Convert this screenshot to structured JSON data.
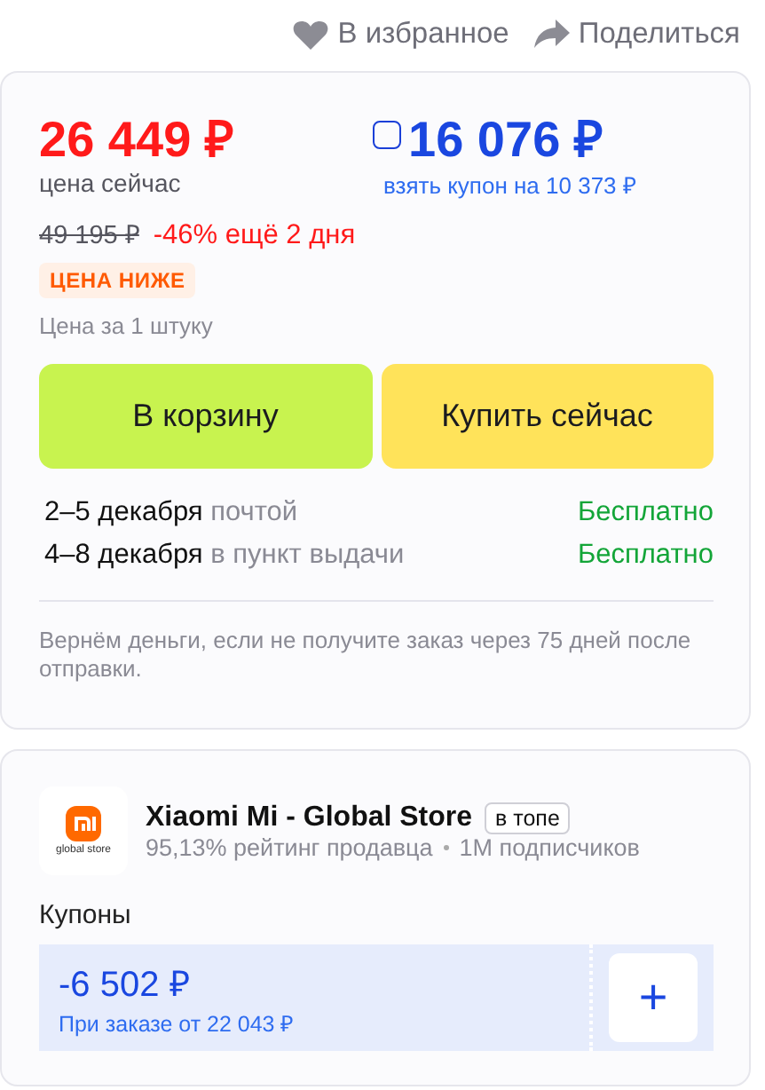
{
  "actions": [
    {
      "kind": "favorite",
      "label": "В избранное"
    },
    {
      "kind": "share",
      "label": "Поделиться"
    }
  ],
  "price": {
    "current": "26 449 ₽",
    "current_caption": "цена сейчас",
    "coupon_checked": false,
    "coupon_price": "16 076 ₽",
    "coupon_link": "взять купон на 10 373 ₽",
    "old_price": "49 195 ₽",
    "discount": "-46% ещё 2 дня",
    "badge": "ЦЕНА НИЖЕ",
    "unit_note": "Цена за 1 штуку"
  },
  "buttons": [
    {
      "kind": "cart",
      "label": "В корзину"
    },
    {
      "kind": "buy",
      "label": "Купить сейчас"
    }
  ],
  "delivery": [
    {
      "dates": "2–5 декабря",
      "method": "почтой",
      "cost": "Бесплатно"
    },
    {
      "dates": "4–8 декабря",
      "method": "в пункт выдачи",
      "cost": "Бесплатно"
    }
  ],
  "guarantee": "Вернём деньги, если не получите заказ через 75 дней после отправки.",
  "seller": {
    "logo_caption": "global store",
    "name": "Xiaomi Mi - Global Store",
    "badge": "в топе",
    "rating": "95,13% рейтинг продавца",
    "followers": "1M подписчиков"
  },
  "coupons": {
    "title": "Купоны",
    "items": [
      {
        "amount": "-6 502 ₽",
        "condition": "При заказе от 22 043 ₽",
        "add": "+"
      }
    ]
  }
}
